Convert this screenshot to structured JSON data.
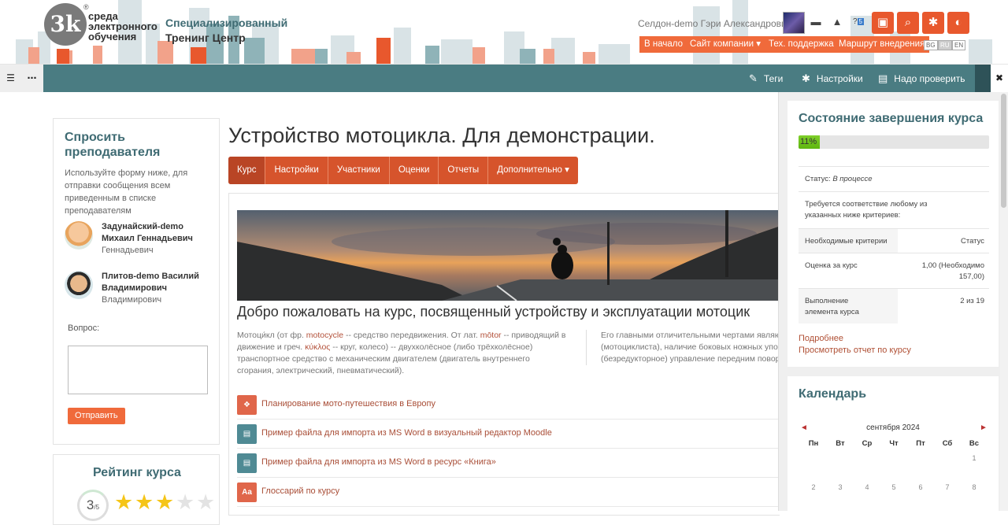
{
  "header": {
    "logo_mark": "3k",
    "logo_reg": "®",
    "logo_text": [
      "среда",
      "электронного",
      "обучения"
    ],
    "org_line1": "Специализированный",
    "org_line2": "Тренинг Центр",
    "user_name": "Селдон-demo Гэри Александрович",
    "notification_count": "5",
    "nav": [
      "В начало",
      "Сайт компании ▾",
      "Тех. поддержка",
      "Маршрут внедрения"
    ],
    "langs": [
      "BG",
      "RU",
      "EN"
    ],
    "active_lang": "RU"
  },
  "toolbar": {
    "left_icons": [
      "list-icon",
      "more-icon"
    ],
    "items": [
      {
        "icon": "tag-icon",
        "label": "Теги"
      },
      {
        "icon": "gear-icon",
        "label": "Настройки"
      },
      {
        "icon": "review-icon",
        "label": "Надо проверить"
      }
    ],
    "close": "✖"
  },
  "ask_block": {
    "title": "Спросить преподавателя",
    "description": "Используйте форму ниже, для отправки сообщения всем приведенным в списке преподавателям",
    "teachers": [
      {
        "name": "Задунайский-demo Михаил Геннадьевич",
        "sub": "Геннадьевич"
      },
      {
        "name": "Плитов-demo Василий Владимирович",
        "sub": "Владимирович"
      }
    ],
    "question_label": "Вопрос:",
    "question_value": "",
    "send_label": "Отправить"
  },
  "rating_block": {
    "title": "Рейтинг курса",
    "value": "3",
    "of": "/5",
    "stars_filled": 3,
    "stars_total": 5
  },
  "course": {
    "title": "Устройство мотоцикла. Для демонстрации.",
    "tabs": [
      "Курс",
      "Настройки",
      "Участники",
      "Оценки",
      "Отчеты",
      "Дополнительно ▾"
    ],
    "welcome": "Добро пожаловать на курс, посвященный устройству и эксплуатации мотоцик",
    "intro_parts": [
      "Мотоци́кл (от фр. ",
      "motocycle",
      " -- средство передвижения. От лат. ",
      "mōtor",
      " -- приводящий в движение и греч. ",
      "κύκλος",
      " -- круг, колесо) -- двухколёсное (либо трёхколёсное) транспортное средство с механическим двигателем (двигатель внутреннего сгорания, электрический, пневматический)."
    ],
    "col2_lines": [
      "Его главными отличительными чертами являютс",
      "(мотоциклиста), наличие боковых ножных упоров",
      "(безредукторное) управление передним поворот"
    ],
    "activities": [
      {
        "icon": "scorm-icon",
        "icon_text": "❖",
        "color": "#e0664a",
        "label": "Планирование мото-путешествия в Европу"
      },
      {
        "icon": "word-import-icon",
        "icon_text": "▤",
        "color": "#4f8a94",
        "label": "Пример файла для импорта из MS Word в визуальный редактор Moodle"
      },
      {
        "icon": "book-icon",
        "icon_text": "▤",
        "color": "#4f8a94",
        "label": "Пример файла для импорта из MS Word в ресурс «Книга»"
      },
      {
        "icon": "glossary-icon",
        "icon_text": "Aa",
        "color": "#e0664a",
        "label": "Глоссарий по курсу"
      }
    ]
  },
  "completion": {
    "title": "Состояние завершения курса",
    "progress_percent": 11,
    "progress_label": "11%",
    "status_label": "Статус:",
    "status_value": "В процессе",
    "requirement": "Требуется соответствие любому из указанных ниже критериев:",
    "col_criteria": "Необходимые критерии",
    "col_status": "Статус",
    "rows": [
      {
        "criteria": "Оценка за курс",
        "status": "1,00 (Необходимо 157,00)"
      },
      {
        "criteria": "Выполнение элемента курса",
        "status": "2 из 19"
      }
    ],
    "link_more": "Подробнее",
    "link_report": "Просмотреть отчет по курсу"
  },
  "calendar": {
    "title": "Календарь",
    "month": "сентября 2024",
    "prev": "◄",
    "next": "►",
    "weekdays": [
      "Пн",
      "Вт",
      "Ср",
      "Чт",
      "Пт",
      "Сб",
      "Вс"
    ],
    "rows": [
      [
        "",
        "",
        "",
        "",
        "",
        "",
        "1"
      ],
      [
        "2",
        "3",
        "4",
        "5",
        "6",
        "7",
        "8"
      ]
    ]
  }
}
